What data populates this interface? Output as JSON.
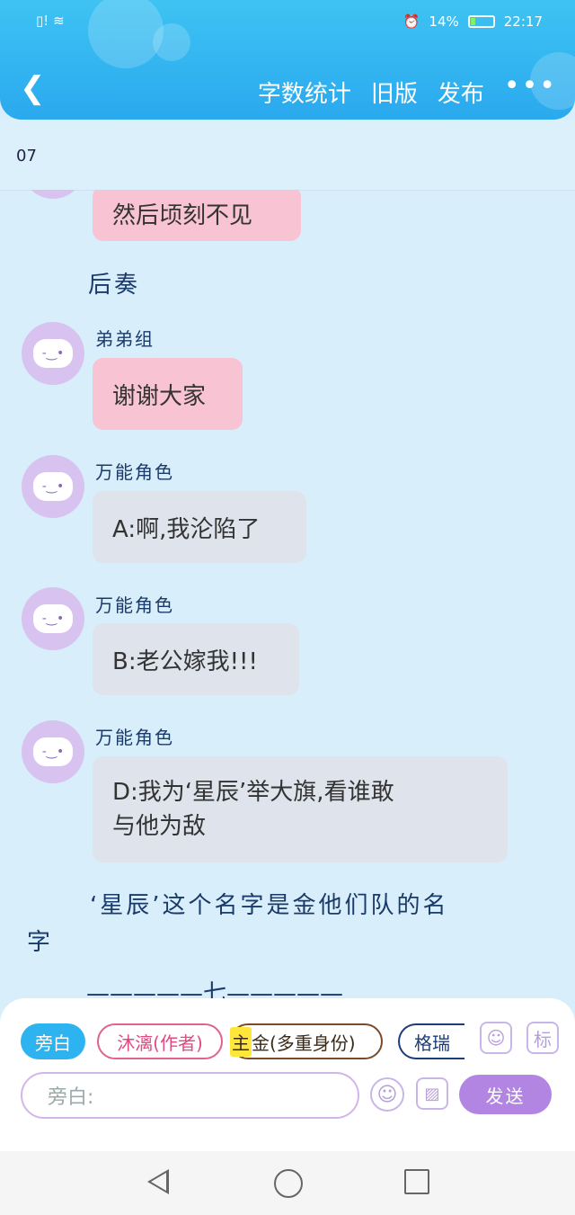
{
  "status": {
    "time": "22:17",
    "battery": "14%"
  },
  "header": {
    "back_icon": "chevron-left-icon",
    "word_count": "字数统计",
    "old_version": "旧版",
    "publish": "发布",
    "more": "•••"
  },
  "subheader": {
    "chapter": "07"
  },
  "messages": {
    "m0": {
      "text": "然后顷刻不见"
    },
    "narr1": "后奏",
    "m1": {
      "name": "弟弟组",
      "text": "谢谢大家"
    },
    "m2": {
      "name": "万能角色",
      "text": "A:啊,我沦陷了"
    },
    "m3": {
      "name": "万能角色",
      "text": "B:老公嫁我!!!"
    },
    "m4": {
      "name": "万能角色",
      "line1": "D:我为‘星辰’举大旗,看谁敢",
      "line2": "与他为敌"
    },
    "narr2_line1": "‘星辰’这个名字是金他们队的名",
    "narr2_line2": "字",
    "narr3": "—————七—————"
  },
  "composer": {
    "tabs": {
      "narrator": "旁白",
      "author": "沐漓(作者)",
      "gold_hl": "主",
      "gold": "金(多重身份)",
      "gereui": "格瑞"
    },
    "profile_icon": "person-card-icon",
    "tag_label": "标",
    "input_placeholder": "旁白:",
    "emoji_icon": "smile-icon",
    "image_icon": "image-icon",
    "send": "发送"
  },
  "navbar": {
    "back": "triangle-back-icon",
    "home": "circle-home-icon",
    "recent": "square-recent-icon"
  },
  "colors": {
    "header": "#2aa9ee",
    "bg": "#d9eefb",
    "pink_bubble": "#f8c3d2",
    "gray_bubble": "#dee3ec",
    "send": "#b285e2"
  }
}
